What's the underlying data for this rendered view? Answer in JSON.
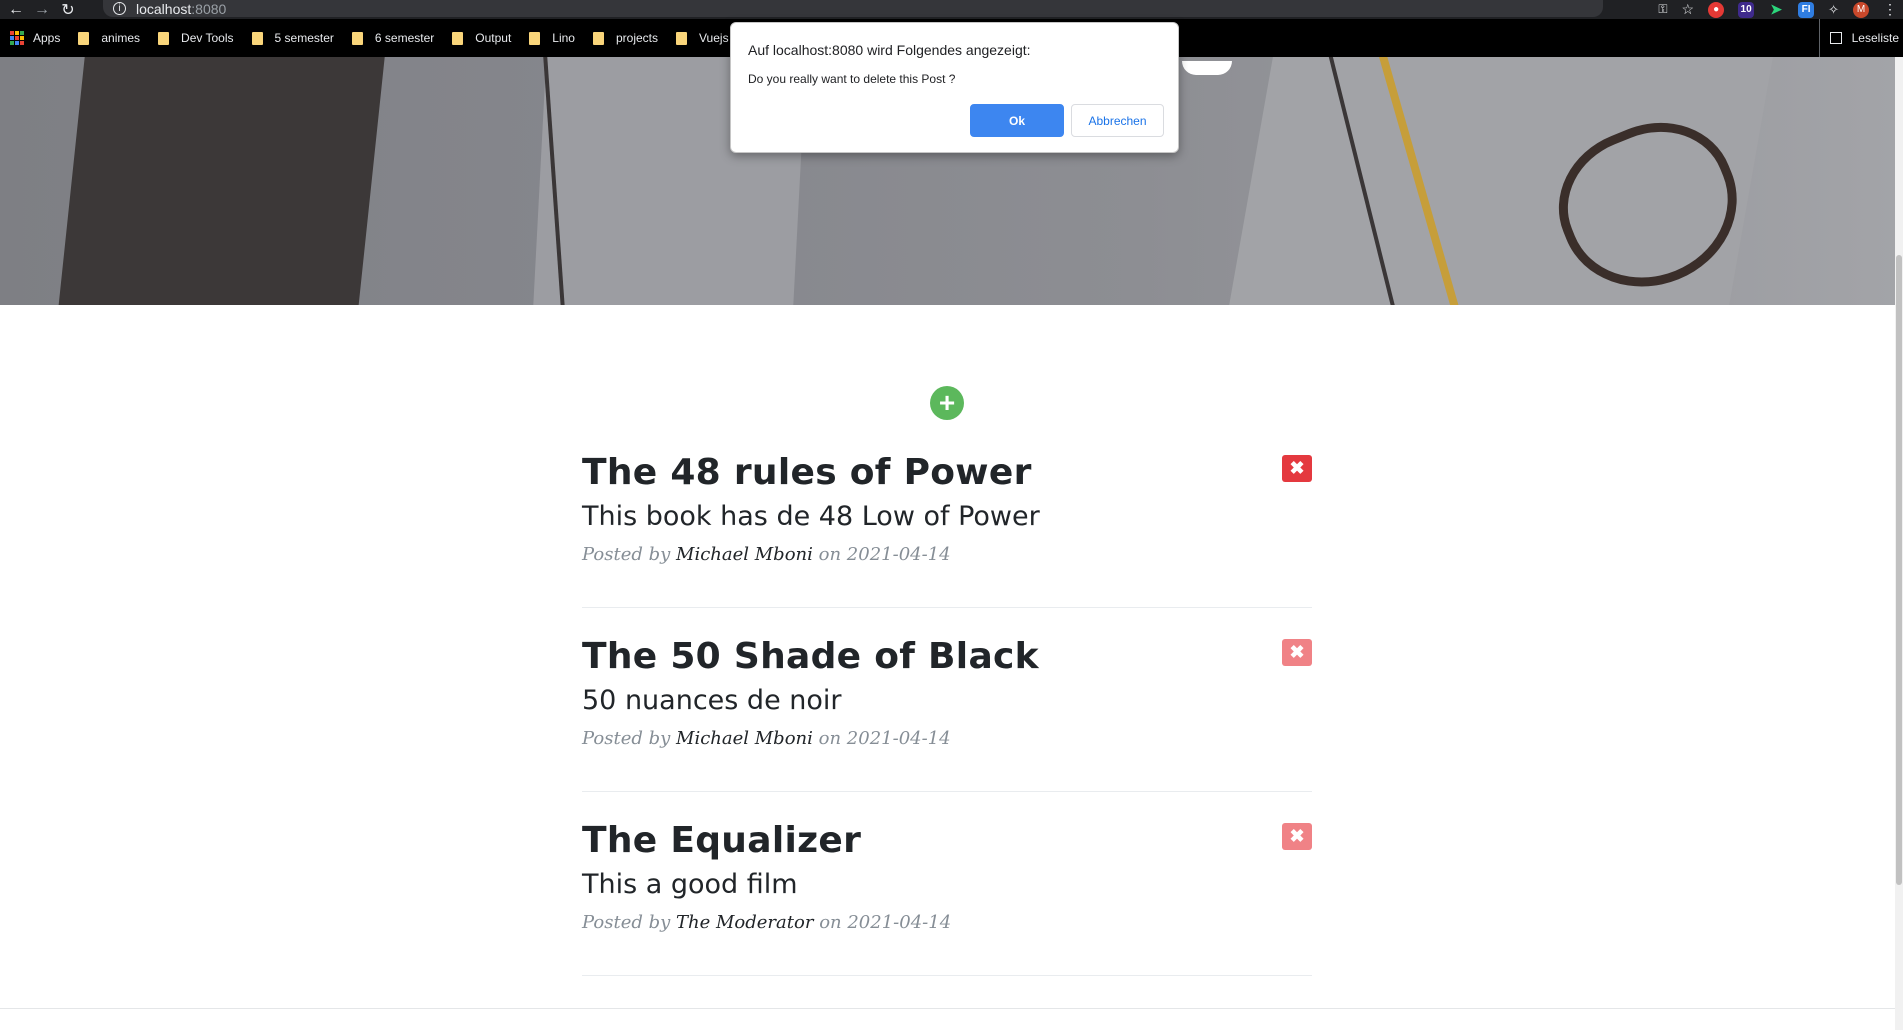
{
  "browser": {
    "url_host": "localhost",
    "url_port": ":8080",
    "bookmarks": [
      "animes",
      "Dev Tools",
      "5 semester",
      "6 semester",
      "Output",
      "Lino",
      "projects",
      "Vuejs"
    ],
    "apps_label": "Apps",
    "reading_list_label": "Leseliste",
    "extension_badge": "10",
    "profile_initial": "M",
    "ext_label": "FI"
  },
  "dialog": {
    "title": "Auf localhost:8080 wird Folgendes angezeigt:",
    "message": "Do you really want to delete this Post ?",
    "ok_label": "Ok",
    "cancel_label": "Abbrechen"
  },
  "posts": [
    {
      "title": "The 48 rules of Power",
      "subtitle": "This book has de 48 Low of Power",
      "posted_by": "Posted by",
      "author": "Michael Mboni",
      "on": "on",
      "date": "2021-04-14"
    },
    {
      "title": "The 50 Shade of Black",
      "subtitle": "50 nuances de noir",
      "posted_by": "Posted by",
      "author": "Michael Mboni",
      "on": "on",
      "date": "2021-04-14"
    },
    {
      "title": "The Equalizer",
      "subtitle": "This a good film",
      "posted_by": "Posted by",
      "author": "The Moderator",
      "on": "on",
      "date": "2021-04-14"
    }
  ],
  "colors": {
    "add_button": "#5cb85c",
    "delete_button_active": "#e4393f",
    "delete_button_inactive": "#f08286",
    "dialog_ok": "#3d86f0"
  },
  "icons": {
    "add": "plus-circle-icon",
    "delete": "close-square-icon"
  }
}
